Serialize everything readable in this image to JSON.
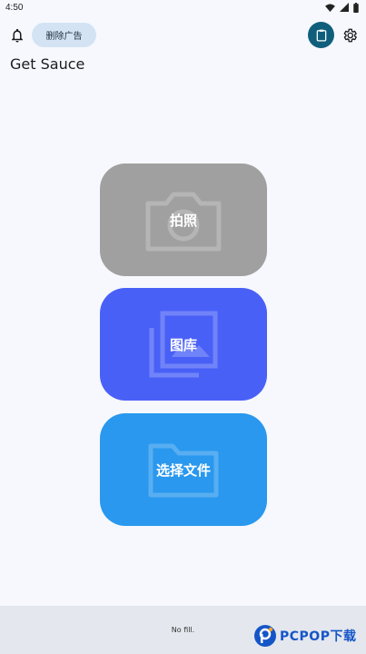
{
  "status_bar": {
    "time": "4:50"
  },
  "header": {
    "remove_ads_label": "删除广告",
    "app_title": "Get Sauce"
  },
  "actions": [
    {
      "label": "拍照",
      "icon": "camera-icon",
      "color": "#a0a0a0"
    },
    {
      "label": "图库",
      "icon": "photo-library-icon",
      "color": "#4960f7"
    },
    {
      "label": "选择文件",
      "icon": "folder-icon",
      "color": "#2998ee"
    }
  ],
  "ad_banner": {
    "text": "No fill."
  },
  "watermark": {
    "brand": "PCPOP下载"
  },
  "colors": {
    "background": "#f6f8fd",
    "chip": "#d3e3f4",
    "clipboard_button": "#0f5f7c"
  }
}
